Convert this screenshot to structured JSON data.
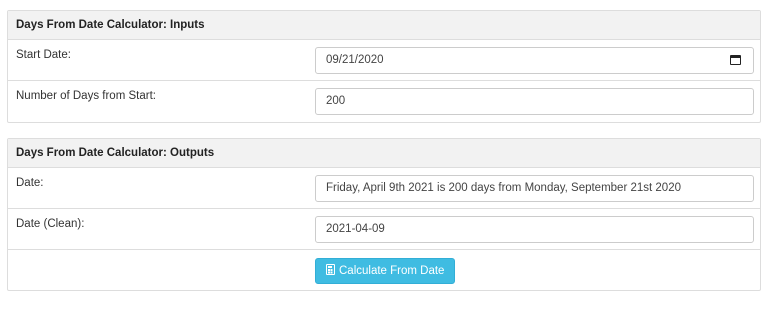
{
  "inputs_panel": {
    "title": "Days From Date Calculator: Inputs",
    "start_date_label": "Start Date:",
    "start_date_value": "09/21/2020",
    "days_label": "Number of Days from Start:",
    "days_value": "200"
  },
  "outputs_panel": {
    "title": "Days From Date Calculator: Outputs",
    "date_label": "Date:",
    "date_value": "Friday, April 9th 2021 is 200 days from Monday, September 21st 2020",
    "date_clean_label": "Date (Clean):",
    "date_clean_value": "2021-04-09",
    "calculate_button_label": "Calculate From Date"
  },
  "icons": {
    "date_picker": "calendar-icon",
    "calculate": "calculator-icon"
  },
  "colors": {
    "button_bg": "#3fbce2",
    "heading_bg": "#f2f2f2",
    "border": "#dddddd"
  }
}
